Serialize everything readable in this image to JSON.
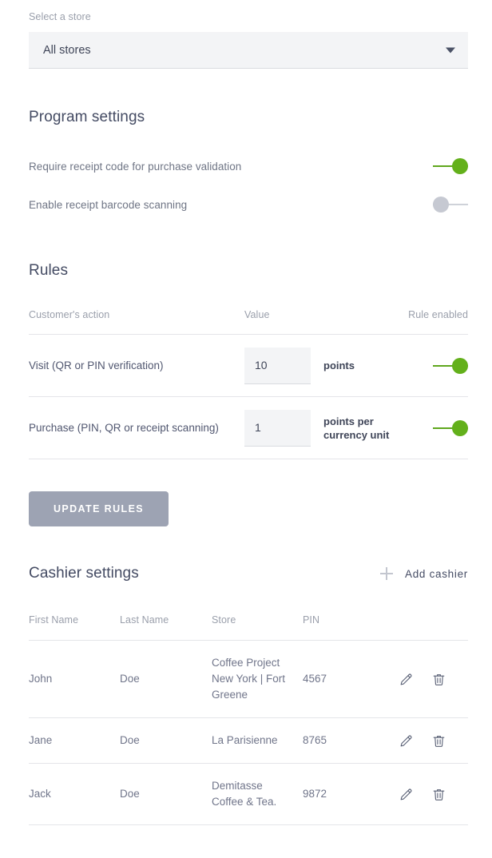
{
  "store_selector": {
    "label": "Select a store",
    "value": "All stores",
    "arrow_icon": "chevron-down-icon"
  },
  "program_settings": {
    "title": "Program settings",
    "items": [
      {
        "label": "Require receipt code for purchase validation",
        "enabled": true
      },
      {
        "label": "Enable receipt barcode scanning",
        "enabled": false
      }
    ]
  },
  "rules": {
    "title": "Rules",
    "columns": [
      "Customer's action",
      "Value",
      "Rule enabled"
    ],
    "rows": [
      {
        "action": "Visit (QR or PIN verification)",
        "value": "10",
        "unit": "points",
        "enabled": true
      },
      {
        "action": "Purchase (PIN, QR or receipt scanning)",
        "value": "1",
        "unit": "points per currency unit",
        "enabled": true
      }
    ],
    "update_button": "UPDATE RULES"
  },
  "cashier_settings": {
    "title": "Cashier settings",
    "add_label": "Add cashier",
    "add_icon": "plus-icon",
    "columns": [
      "First Name",
      "Last Name",
      "Store",
      "PIN"
    ],
    "rows": [
      {
        "first": "John",
        "last": "Doe",
        "store": "Coffee Project New York | Fort Greene",
        "pin": "4567",
        "edit_icon": "pencil-icon",
        "delete_icon": "trash-icon"
      },
      {
        "first": "Jane",
        "last": "Doe",
        "store": "La Parisienne",
        "pin": "8765",
        "edit_icon": "pencil-icon",
        "delete_icon": "trash-icon"
      },
      {
        "first": "Jack",
        "last": "Doe",
        "store": "Demitasse Coffee & Tea.",
        "pin": "9872",
        "edit_icon": "pencil-icon",
        "delete_icon": "trash-icon"
      }
    ]
  },
  "colors": {
    "toggle_on": "#63b01b",
    "toggle_off": "#c6c9d2",
    "button_bg": "#9da3b3",
    "heading": "#444b63",
    "muted_text": "#9a9fab",
    "field_bg": "#f3f4f6"
  }
}
